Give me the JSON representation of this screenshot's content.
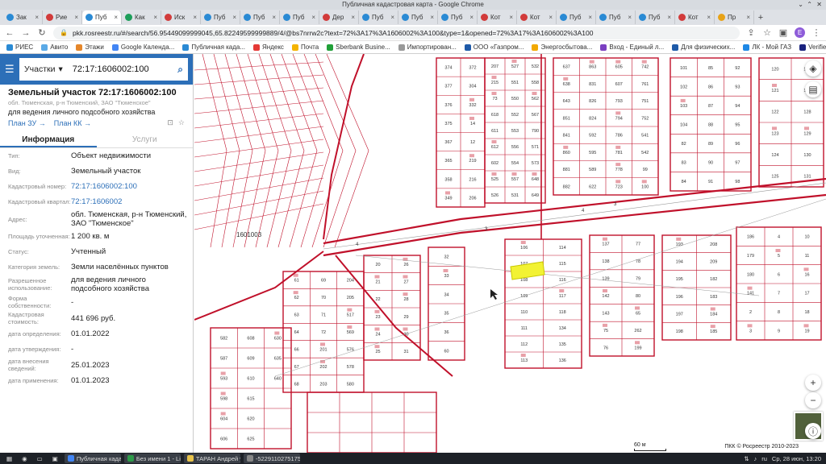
{
  "window": {
    "title": "Публичная кадастровая карта - Google Chrome",
    "controls": [
      "⌄",
      "⌃",
      "✕"
    ]
  },
  "tabs": [
    {
      "label": "Зак",
      "color": "#2a8ad4"
    },
    {
      "label": "Рие",
      "color": "#d23b3b"
    },
    {
      "label": "Пуб",
      "color": "#2a8ad4",
      "active": true
    },
    {
      "label": "Как",
      "color": "#1d9e5a"
    },
    {
      "label": "Иск",
      "color": "#d23b3b"
    },
    {
      "label": "Пуб",
      "color": "#2a8ad4"
    },
    {
      "label": "Пуб",
      "color": "#2a8ad4"
    },
    {
      "label": "Пуб",
      "color": "#2a8ad4"
    },
    {
      "label": "Дер",
      "color": "#d23b3b"
    },
    {
      "label": "Пуб",
      "color": "#2a8ad4"
    },
    {
      "label": "Пуб",
      "color": "#2a8ad4"
    },
    {
      "label": "Пуб",
      "color": "#2a8ad4"
    },
    {
      "label": "Кот",
      "color": "#d23b3b"
    },
    {
      "label": "Кот",
      "color": "#d23b3b"
    },
    {
      "label": "Пуб",
      "color": "#2a8ad4"
    },
    {
      "label": "Пуб",
      "color": "#2a8ad4"
    },
    {
      "label": "Пуб",
      "color": "#2a8ad4"
    },
    {
      "label": "Кот",
      "color": "#d23b3b"
    },
    {
      "label": "Пр",
      "color": "#e8a317"
    }
  ],
  "address_bar": {
    "url": "pkk.rosreestr.ru/#/search/56.95449099999045,65.82249599999889/4/@bs7nrrw2c?text=72%3A17%3A1606002%3A100&type=1&opened=72%3A17%3A1606002%3A100",
    "profile_initial": "E"
  },
  "bookmarks": [
    {
      "label": "РИЕС",
      "color": "#2a8ad4"
    },
    {
      "label": "Авито",
      "color": "#5aa9e6"
    },
    {
      "label": "Этажи",
      "color": "#e5862a"
    },
    {
      "label": "Google Календа...",
      "color": "#4285f4"
    },
    {
      "label": "Публичная када...",
      "color": "#2a8ad4"
    },
    {
      "label": "Яндекс",
      "color": "#e53935"
    },
    {
      "label": "Почта",
      "color": "#f4b400"
    },
    {
      "label": "Sberbank Busine...",
      "color": "#21a038"
    },
    {
      "label": "Импортирован...",
      "color": "#999999"
    },
    {
      "label": "ООО «Газпром...",
      "color": "#1e5aa8"
    },
    {
      "label": "Энергосбытова...",
      "color": "#f2a900"
    },
    {
      "label": "Вход - Единый л...",
      "color": "#7a3fc1"
    },
    {
      "label": "Для физических...",
      "color": "#1e5aa8"
    },
    {
      "label": "ЛК - Мой ГАЗ",
      "color": "#1e88e5"
    },
    {
      "label": "Verified by VISA -...",
      "color": "#1a237e"
    }
  ],
  "search": {
    "type": "Участки",
    "query": "72:17:1606002:100"
  },
  "object": {
    "title": "Земельный участок 72:17:1606002:100",
    "address_short": "обл. Тюменская, р-н Тюменский, ЗАО \"Тюменское\"",
    "use": "для ведения личного подсобного хозяйства",
    "plan_zu": "План ЗУ",
    "plan_kk": "План КК"
  },
  "panel_tabs": [
    "Информация",
    "Услуги"
  ],
  "properties": [
    {
      "label": "Тип:",
      "value": "Объект недвижимости"
    },
    {
      "label": "Вид:",
      "value": "Земельный участок"
    },
    {
      "label": "Кадастровый номер:",
      "value": "72:17:1606002:100",
      "link": true
    },
    {
      "label": "Кадастровый квартал:",
      "value": "72:17:1606002",
      "link": true
    },
    {
      "label": "Адрес:",
      "value": "обл. Тюменская, р-н Тюменский, ЗАО \"Тюменское\""
    },
    {
      "label": "Площадь уточненная:",
      "value": "1 200 кв. м"
    },
    {
      "label": "Статус:",
      "value": "Учтенный"
    },
    {
      "label": "Категория земель:",
      "value": "Земли населённых пунктов"
    },
    {
      "label": "Разрешенное использование:",
      "value": "для ведения личного подсобного хозяйства"
    },
    {
      "label": "Форма собственности:",
      "value": "-"
    },
    {
      "label": "Кадастровая стоимость:",
      "value": "441 696 руб."
    },
    {
      "label": "дата определения:",
      "value": "01.01.2022"
    },
    {
      "label": "дата утверждения:",
      "value": "-"
    },
    {
      "label": "дата внесения сведений:",
      "value": "25.01.2023"
    },
    {
      "label": "дата применения:",
      "value": "01.01.2023"
    }
  ],
  "map": {
    "quarter_label": "1601003",
    "road_labels": [
      "3",
      "4",
      "4",
      "3"
    ],
    "lot_labels": [
      "374",
      "377",
      "376",
      "375",
      "367",
      "365",
      "358",
      "349",
      "372",
      "304",
      "332",
      "14",
      "12",
      "219",
      "216",
      "206",
      "207",
      "215",
      "73",
      "618",
      "611",
      "612",
      "602",
      "525",
      "526",
      "527",
      "551",
      "550",
      "552",
      "553",
      "556",
      "554",
      "557",
      "531",
      "532",
      "558",
      "562",
      "567",
      "790",
      "571",
      "573",
      "648",
      "649",
      "637",
      "638",
      "643",
      "851",
      "841",
      "860",
      "881",
      "882",
      "863",
      "831",
      "826",
      "824",
      "592",
      "595",
      "589",
      "622",
      "605",
      "607",
      "793",
      "794",
      "786",
      "781",
      "778",
      "723",
      "742",
      "761",
      "751",
      "752",
      "541",
      "542",
      "99",
      "100",
      "101",
      "102",
      "103",
      "104",
      "82",
      "83",
      "84",
      "85",
      "86",
      "87",
      "88",
      "89",
      "90",
      "91",
      "92",
      "93",
      "94",
      "95",
      "96",
      "97",
      "98",
      "120",
      "121",
      "122",
      "123",
      "124",
      "125",
      "126",
      "127",
      "128",
      "129",
      "130",
      "131",
      "106",
      "107",
      "108",
      "109",
      "110",
      "111",
      "112",
      "113",
      "114",
      "115",
      "116",
      "117",
      "118",
      "134",
      "135",
      "136",
      "137",
      "138",
      "139",
      "142",
      "143",
      "75",
      "76",
      "77",
      "78",
      "79",
      "80",
      "65",
      "262",
      "199",
      "193",
      "194",
      "195",
      "196",
      "197",
      "198",
      "208",
      "209",
      "182",
      "183",
      "184",
      "185",
      "186",
      "179",
      "180",
      "141",
      "2",
      "3",
      "4",
      "5",
      "6",
      "7",
      "8",
      "9",
      "10",
      "11",
      "16",
      "17",
      "18",
      "19",
      "20",
      "21",
      "22",
      "23",
      "24",
      "25",
      "26",
      "27",
      "28",
      "29",
      "30",
      "31",
      "32",
      "33",
      "34",
      "35",
      "36",
      "60",
      "61",
      "62",
      "63",
      "64",
      "66",
      "67",
      "68",
      "69",
      "70",
      "71",
      "72",
      "201",
      "202",
      "203",
      "204",
      "205",
      "517",
      "569",
      "576",
      "578",
      "580",
      "582",
      "587",
      "593",
      "598",
      "604",
      "606",
      "608",
      "609",
      "610",
      "615",
      "620",
      "625",
      "630",
      "635",
      "640"
    ],
    "scale": "60 м",
    "copyright": "ПКК © Росреестр 2010-2023",
    "highlight_color": "#f2f233",
    "boundary_color": "#c0102a"
  },
  "taskbar": {
    "items": [
      {
        "label": "Публичная кадастровая ...",
        "color": "#4285f4"
      },
      {
        "label": "Без имени 1 - LibreOffice ...",
        "color": "#2e9b49"
      },
      {
        "label": "ТАРАН Андрей участки",
        "color": "#e8c34a"
      },
      {
        "label": "-522911027517573002...",
        "color": "#888888"
      }
    ],
    "clock": "Ср, 28 июн, 13:20",
    "lang": "ru"
  }
}
